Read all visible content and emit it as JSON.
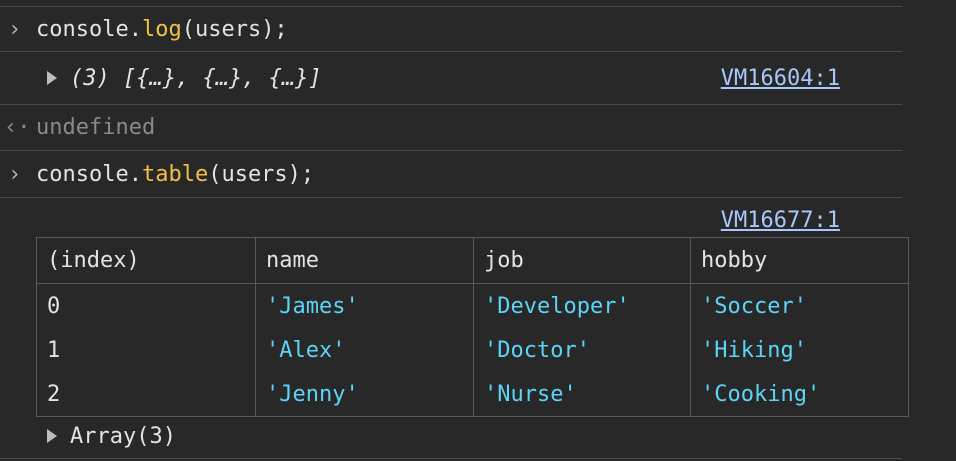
{
  "console": {
    "line1": {
      "prompt": "›",
      "obj": "console.",
      "method": "log",
      "args": "(users);"
    },
    "line2": {
      "summary": "(3) [{…}, {…}, {…}]",
      "source": "VM16604:1"
    },
    "line3": {
      "prompt": "‹·",
      "value": "undefined"
    },
    "line4": {
      "prompt": "›",
      "obj": "console.",
      "method": "table",
      "args": "(users);"
    },
    "line5": {
      "source": "VM16677:1"
    },
    "table": {
      "headers": [
        "(index)",
        "name",
        "job",
        "hobby"
      ],
      "rows": [
        [
          "0",
          "'James'",
          "'Developer'",
          "'Soccer'"
        ],
        [
          "1",
          "'Alex'",
          "'Doctor'",
          "'Hiking'"
        ],
        [
          "2",
          "'Jenny'",
          "'Nurse'",
          "'Cooking'"
        ]
      ]
    },
    "array_label": "Array(3)"
  },
  "colors": {
    "background": "#282828",
    "method": "#f0c046",
    "string": "#5cd4f8",
    "link": "#a8c7fa",
    "muted": "#8a8a8a"
  }
}
